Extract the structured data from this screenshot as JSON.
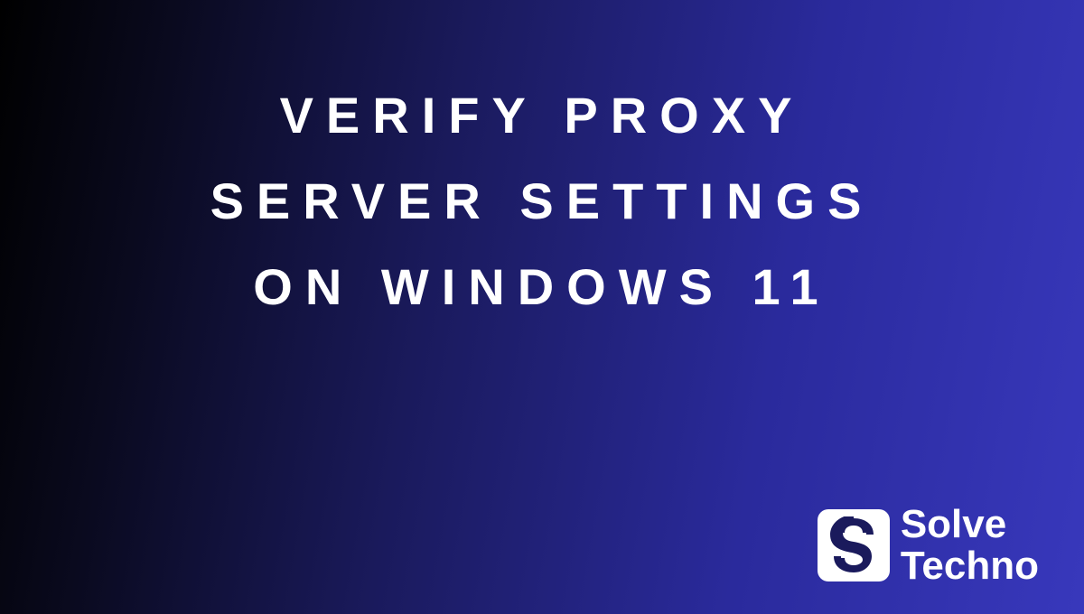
{
  "title": "VERIFY PROXY SERVER SETTINGS ON WINDOWS 11",
  "logo": {
    "line1": "Solve",
    "line2": "Techno"
  }
}
